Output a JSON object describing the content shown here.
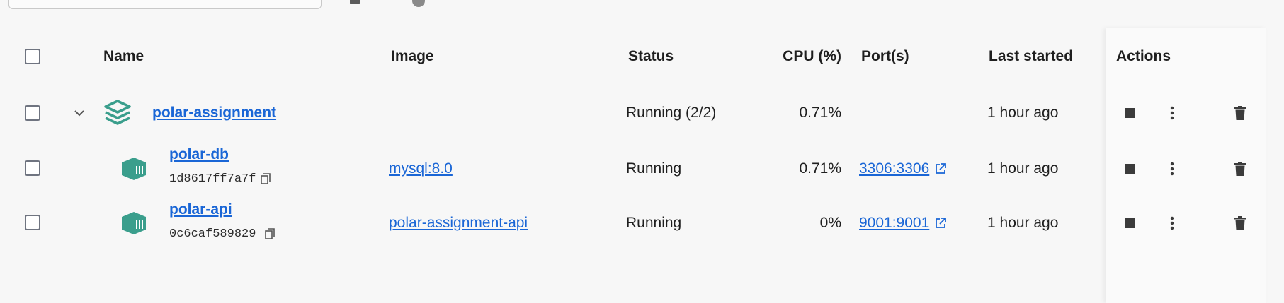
{
  "columns": {
    "name": "Name",
    "image": "Image",
    "status": "Status",
    "cpu": "CPU (%)",
    "ports": "Port(s)",
    "last_started": "Last started",
    "actions": "Actions"
  },
  "group": {
    "name": "polar-assignment",
    "status": "Running (2/2)",
    "cpu": "0.71%",
    "last_started": "1 hour ago"
  },
  "containers": [
    {
      "name": "polar-db",
      "id": "1d8617ff7a7f",
      "image": "mysql:8.0",
      "status": "Running",
      "cpu": "0.71%",
      "port": "3306:3306",
      "last_started": "1 hour ago"
    },
    {
      "name": "polar-api",
      "id": "0c6caf589829",
      "image": "polar-assignment-api",
      "status": "Running",
      "cpu": "0%",
      "port": "9001:9001",
      "last_started": "1 hour ago"
    }
  ],
  "colors": {
    "accent": "#1a66d6",
    "container_icon": "#3a9e8c"
  }
}
